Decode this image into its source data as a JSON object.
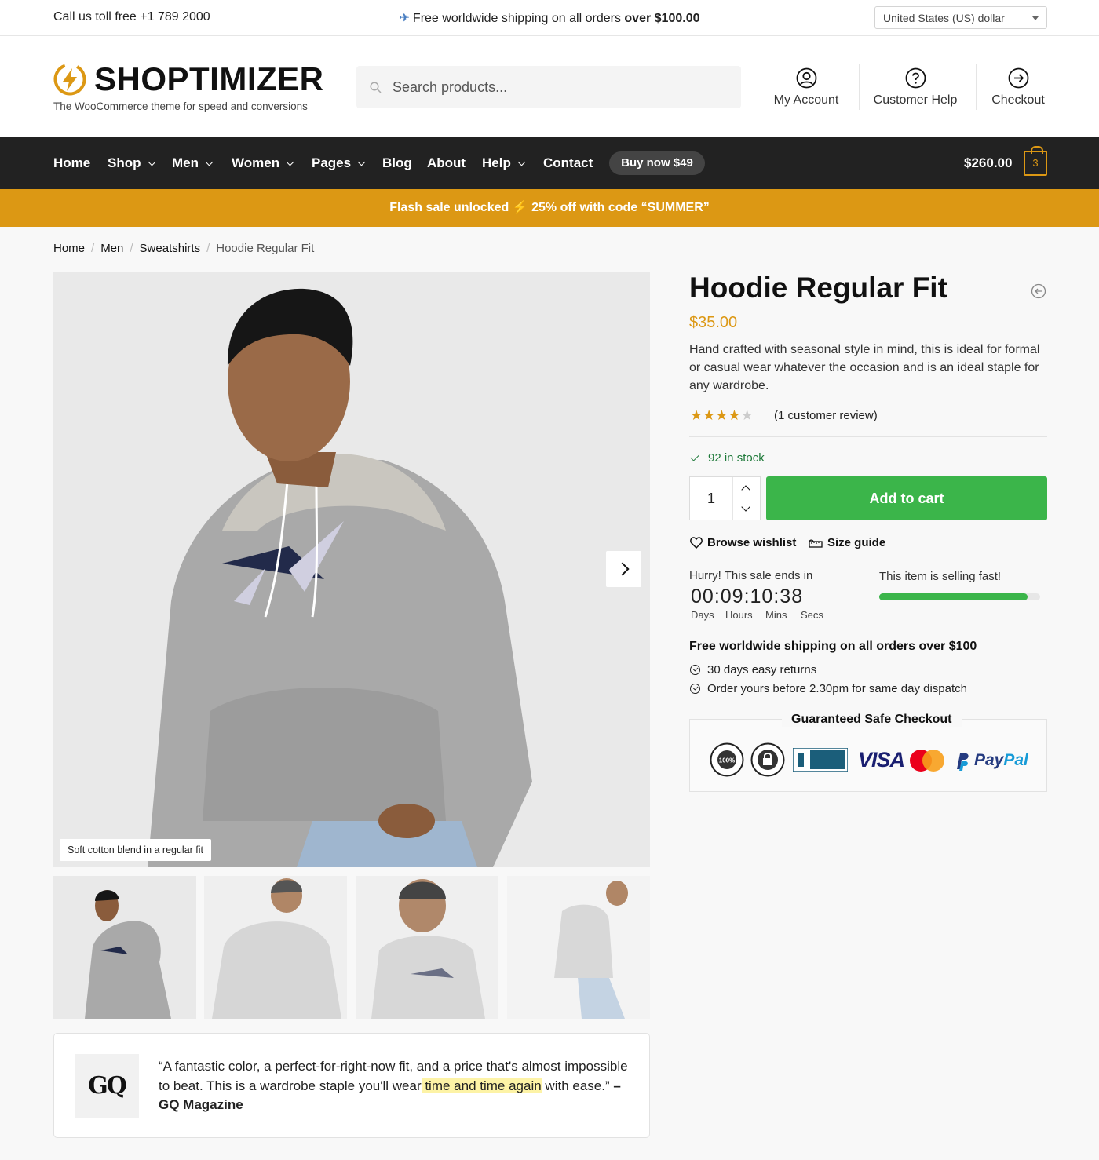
{
  "topbar": {
    "call": "Call us toll free +1 789 2000",
    "shipping_prefix": "Free worldwide shipping on all orders",
    "shipping_bold": "over $100.00",
    "currency": "United States (US) dollar"
  },
  "header": {
    "logo": "SHOPTIMIZER",
    "tagline": "The WooCommerce theme for speed and conversions",
    "search_placeholder": "Search products...",
    "links": [
      "My Account",
      "Customer Help",
      "Checkout"
    ]
  },
  "nav": {
    "items": [
      "Home",
      "Shop",
      "Men",
      "Women",
      "Pages",
      "Blog",
      "About",
      "Help",
      "Contact"
    ],
    "buy_now": "Buy now $49",
    "cart_total": "$260.00",
    "cart_count": "3"
  },
  "flash": {
    "text_a": "Flash sale unlocked",
    "text_b": "25% off with code “SUMMER”"
  },
  "breadcrumb": [
    "Home",
    "Men",
    "Sweatshirts",
    "Hoodie Regular Fit"
  ],
  "gallery": {
    "caption": "Soft cotton blend in a regular fit"
  },
  "product": {
    "title": "Hoodie Regular Fit",
    "price": "$35.00",
    "description": "Hand crafted with seasonal style in mind, this is ideal for formal or casual wear whatever the occasion and is an ideal staple for any wardrobe.",
    "rating": 4,
    "rating_max": 5,
    "review_count": "(1 customer review)",
    "stock": "92 in stock",
    "quantity": "1",
    "add_to_cart": "Add to cart",
    "wishlist": "Browse wishlist",
    "size_guide": "Size guide"
  },
  "countdown": {
    "label": "Hurry! This sale ends in",
    "days": "00",
    "hours": "09",
    "mins": "10",
    "secs": "38",
    "days_label": "Days",
    "hours_label": "Hours",
    "mins_label": "Mins",
    "secs_label": "Secs"
  },
  "selling": {
    "label": "This item is selling fast!",
    "progress": 0.92
  },
  "shipping_info": {
    "heading": "Free worldwide shipping on all orders over $100",
    "bullets": [
      "30 days easy returns",
      "Order yours before 2.30pm for same day dispatch"
    ]
  },
  "checkout": {
    "title": "Guaranteed Safe Checkout",
    "badges": [
      "100%",
      "VISA",
      "Pay",
      "Pal"
    ]
  },
  "review": {
    "logo": "GQ",
    "quote_a": "“A fantastic color, a perfect-for-right-now fit, and a price that's almost impossible to beat. This is a wardrobe staple you'll wear",
    "quote_highlight": " time and time again",
    "quote_b": " with ease.” ",
    "source": "– GQ Magazine"
  },
  "colors": {
    "accent": "#dc9814",
    "nav_bg": "#222222",
    "cta": "#3bb54a",
    "stock": "#1f7a3a"
  }
}
